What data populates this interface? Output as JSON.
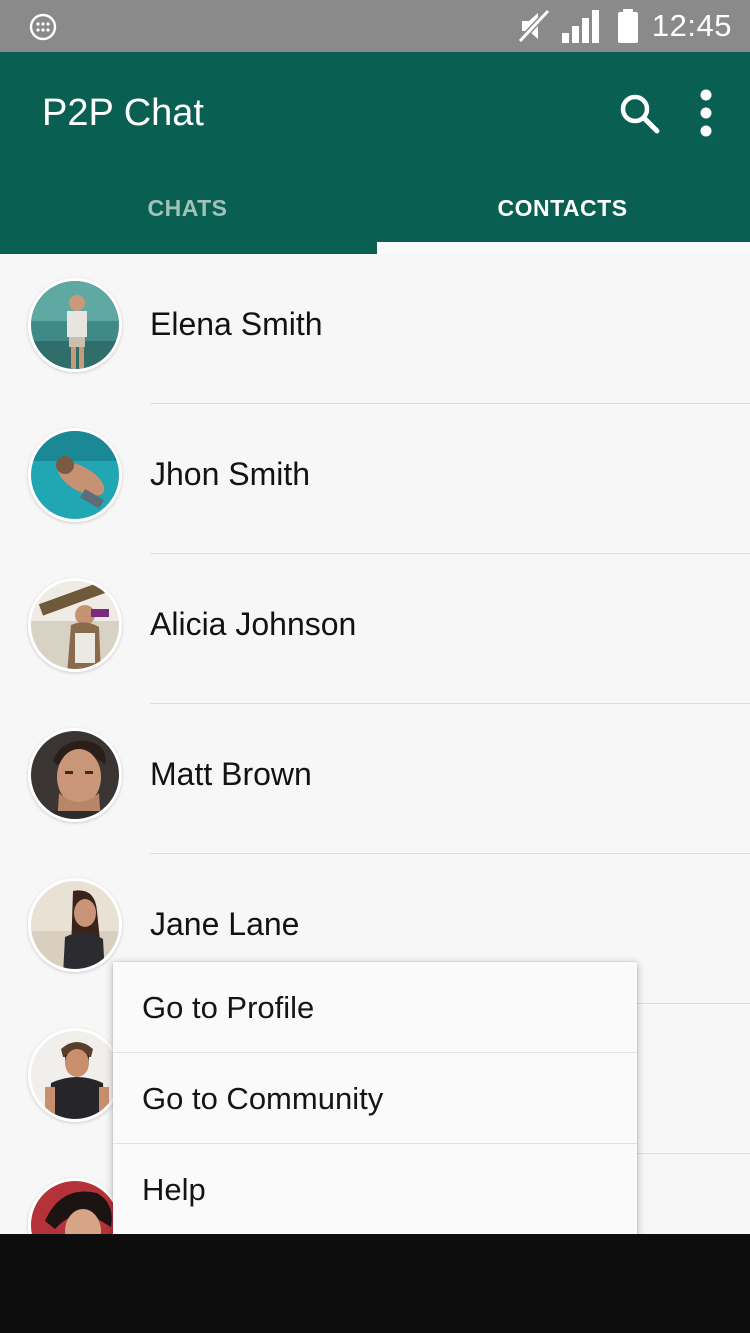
{
  "status_bar": {
    "time": "12:45",
    "icons": [
      "launcher-icon",
      "mute-icon",
      "signal-icon",
      "battery-icon"
    ]
  },
  "app_bar": {
    "title": "P2P Chat",
    "actions": [
      "search-icon",
      "more-vert-icon"
    ],
    "background": "#0a5f53"
  },
  "tabs": [
    {
      "label": "CHATS",
      "active": false
    },
    {
      "label": "CONTACTS",
      "active": true
    }
  ],
  "contacts": [
    {
      "name": "Elena Smith"
    },
    {
      "name": "Jhon Smith"
    },
    {
      "name": "Alicia Johnson"
    },
    {
      "name": "Matt Brown"
    },
    {
      "name": "Jane Lane"
    },
    {
      "name": ""
    },
    {
      "name": ""
    }
  ],
  "popup_menu": {
    "items": [
      {
        "label": "Go to Profile"
      },
      {
        "label": "Go to Community"
      },
      {
        "label": "Help"
      }
    ]
  }
}
